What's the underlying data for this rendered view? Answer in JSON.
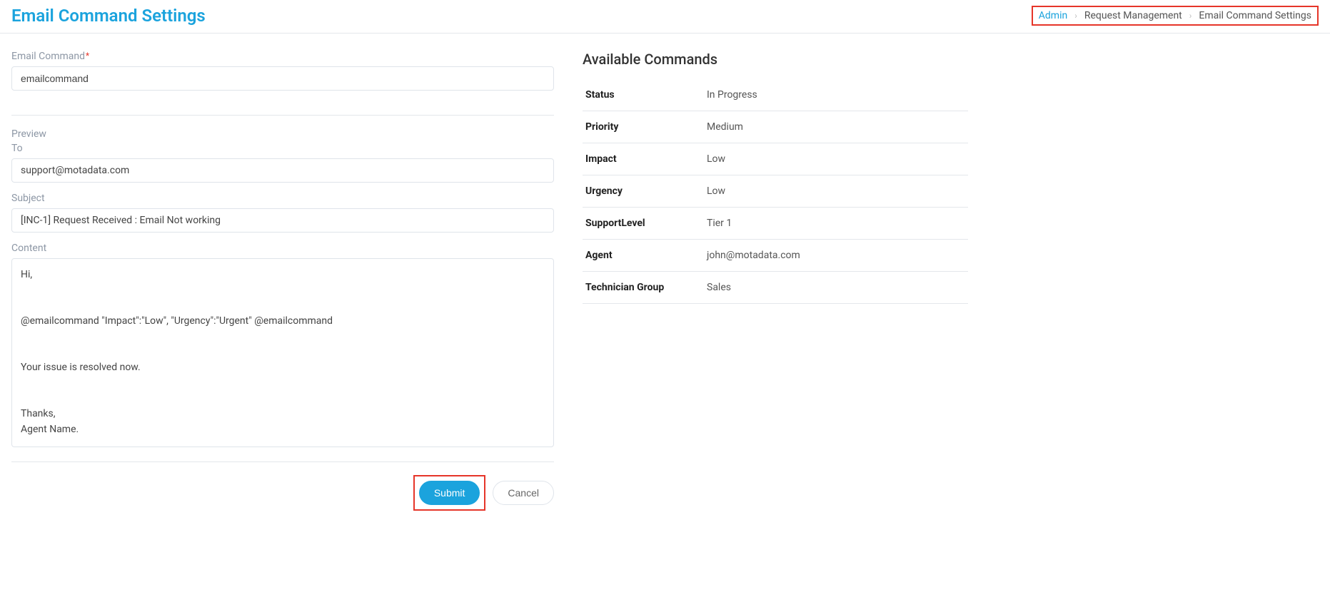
{
  "header": {
    "title": "Email Command Settings"
  },
  "breadcrumb": {
    "items": [
      {
        "label": "Admin",
        "link": true
      },
      {
        "label": "Request Management",
        "link": false
      },
      {
        "label": "Email Command Settings",
        "link": false
      }
    ]
  },
  "form": {
    "email_command_label": "Email Command",
    "email_command_value": "emailcommand",
    "preview_label": "Preview",
    "to_label": "To",
    "to_value": "support@motadata.com",
    "subject_label": "Subject",
    "subject_value": "[INC-1] Request Received : Email Not working",
    "content_label": "Content",
    "content_value": "Hi,\n\n\n@emailcommand \"Impact\":\"Low\", \"Urgency\":\"Urgent\" @emailcommand\n\n\nYour issue is resolved now.\n\n\nThanks,\nAgent Name."
  },
  "buttons": {
    "submit": "Submit",
    "cancel": "Cancel"
  },
  "available_commands": {
    "title": "Available Commands",
    "rows": [
      {
        "key": "Status",
        "value": "In Progress"
      },
      {
        "key": "Priority",
        "value": "Medium"
      },
      {
        "key": "Impact",
        "value": "Low"
      },
      {
        "key": "Urgency",
        "value": "Low"
      },
      {
        "key": "SupportLevel",
        "value": "Tier 1"
      },
      {
        "key": "Agent",
        "value": "john@motadata.com"
      },
      {
        "key": "Technician Group",
        "value": "Sales"
      }
    ]
  }
}
